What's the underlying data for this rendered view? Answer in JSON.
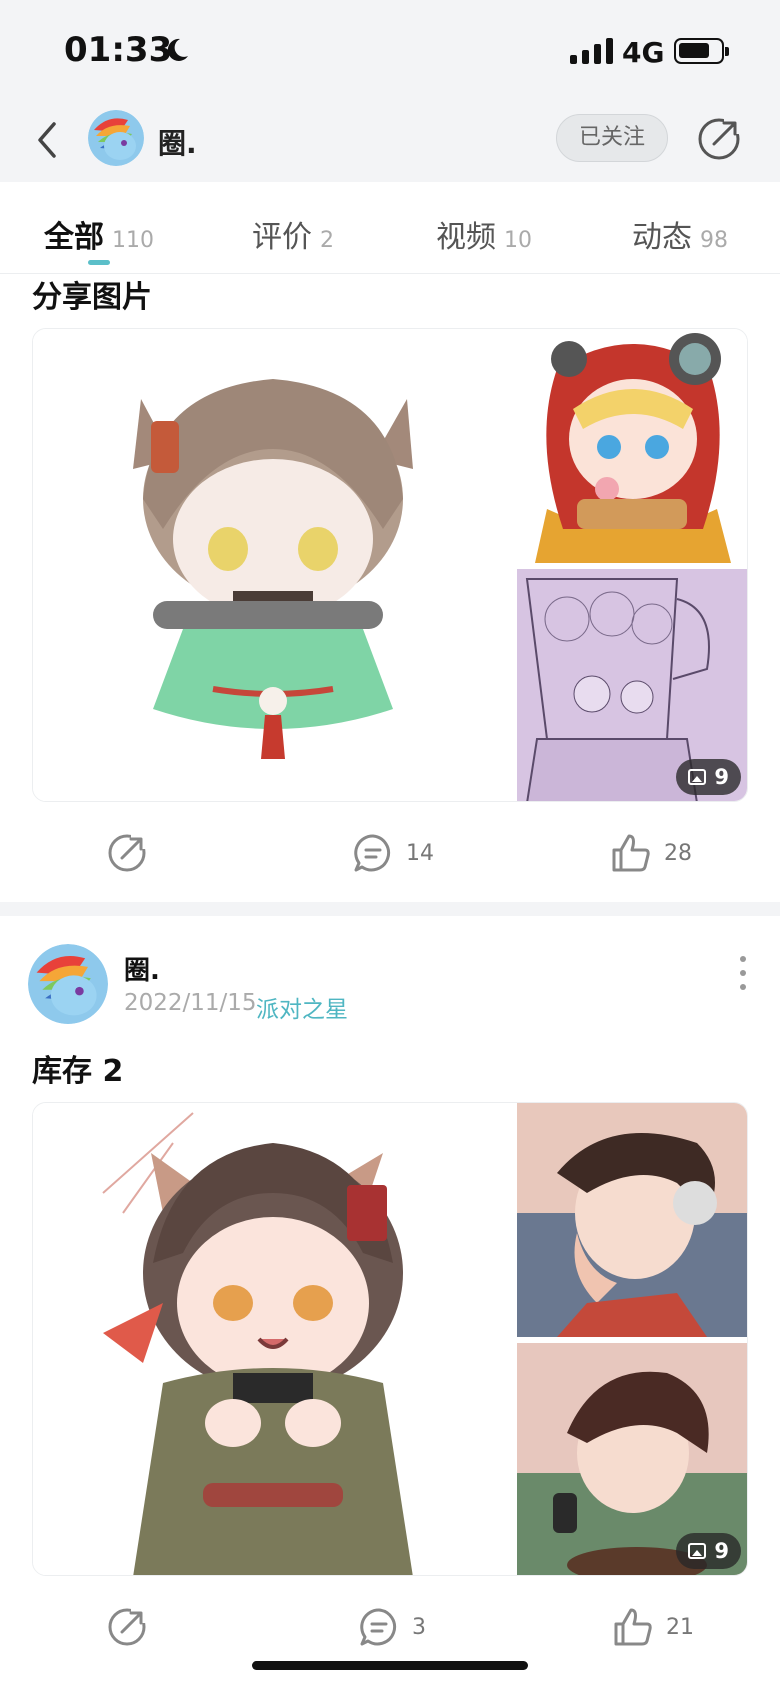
{
  "status": {
    "time": "01:33",
    "network": "4G"
  },
  "nav": {
    "name": "圈.",
    "follow_label": "已关注"
  },
  "tabs": [
    {
      "label": "全部",
      "count": "110"
    },
    {
      "label": "评价",
      "count": "2"
    },
    {
      "label": "视频",
      "count": "10"
    },
    {
      "label": "动态",
      "count": "98"
    }
  ],
  "post1": {
    "title": "分享图片",
    "image_count": "9",
    "comments": "14",
    "likes": "28"
  },
  "post2": {
    "author": "圈.",
    "date": "2022/11/15",
    "tag": "派对之星",
    "title": "库存 2",
    "image_count": "9",
    "comments": "3",
    "likes": "21"
  },
  "icons": [
    "moon-icon",
    "back-icon",
    "share-icon",
    "comment-icon",
    "like-icon",
    "image-icon",
    "more-icon"
  ],
  "colors": {
    "accent": "#5bbfc9",
    "tag": "#4fb6c2",
    "bg_gray": "#f3f4f6"
  }
}
